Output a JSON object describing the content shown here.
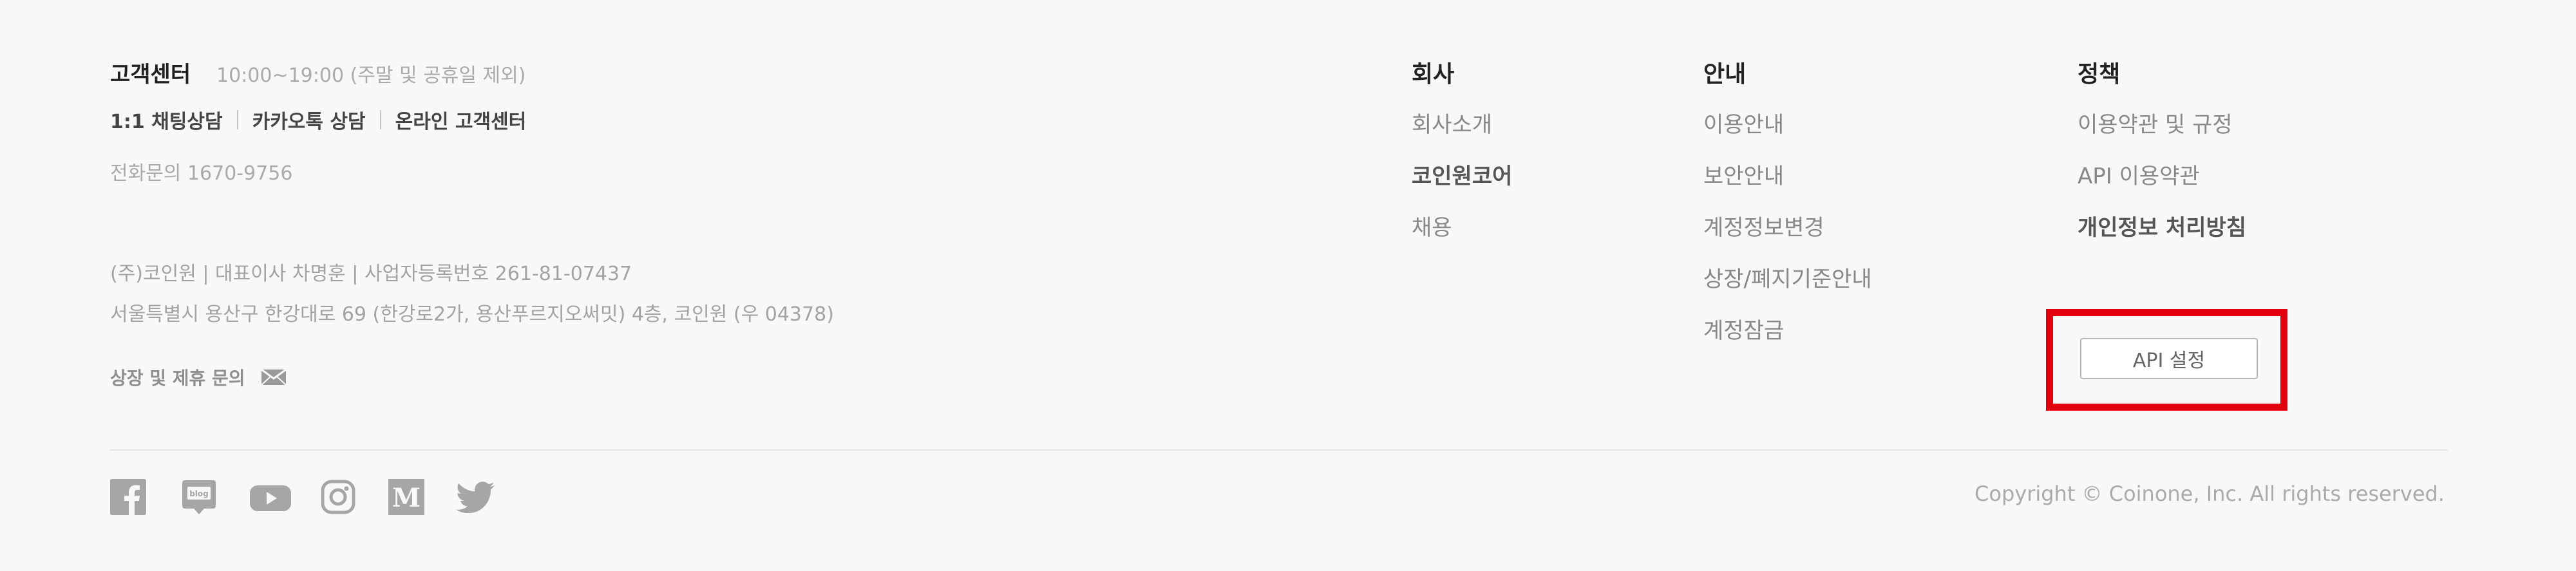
{
  "customer_center": {
    "title": "고객센터",
    "hours": "10:00~19:00 (주말 및 공휴일 제외)",
    "links": [
      "1:1 채팅상담",
      "카카오톡 상담",
      "온라인 고객센터"
    ],
    "phone": "전화문의 1670-9756"
  },
  "company_info": {
    "line1": "(주)코인원 | 대표이사 차명훈 | 사업자등록번호 261-81-07437",
    "line2": "서울특별시 용산구 한강대로 69 (한강로2가, 용산푸르지오써밋) 4층, 코인원 (우 04378)"
  },
  "listing_inquiry": {
    "label": "상장 및 제휴 문의",
    "icon": "mail-icon"
  },
  "columns": [
    {
      "heading": "회사",
      "items": [
        "회사소개",
        "코인원코어",
        "채용"
      ]
    },
    {
      "heading": "안내",
      "items": [
        "이용안내",
        "보안안내",
        "계정정보변경",
        "상장/폐지기준안내",
        "계정잠금"
      ]
    },
    {
      "heading": "정책",
      "items": [
        "이용약관 및 규정",
        "API 이용약관",
        "개인정보 처리방침"
      ]
    }
  ],
  "api_button": {
    "label": "API 설정"
  },
  "social_icons": [
    "facebook-icon",
    "blog-icon",
    "youtube-icon",
    "instagram-icon",
    "medium-icon",
    "twitter-icon"
  ],
  "copyright": "Copyright © Coinone, Inc. All rights reserved.",
  "colors": {
    "highlight": "#e3000f",
    "background": "#f8f8f8",
    "icon": "#a6a6a6"
  }
}
